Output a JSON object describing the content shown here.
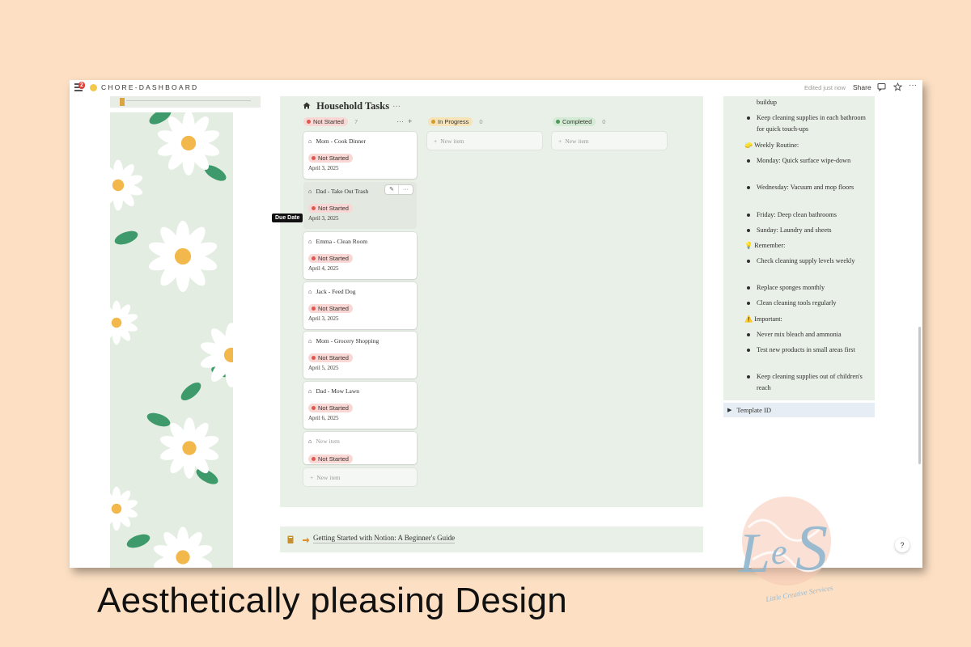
{
  "topbar": {
    "notification_count": "2",
    "page_name": "CHORE-DASHBOARD",
    "edited": "Edited just now",
    "share": "Share"
  },
  "board": {
    "title": "Household Tasks",
    "columns": [
      {
        "status": "Not Started",
        "count": "7",
        "color": "#f8d7d5",
        "dot": "#e0574f"
      },
      {
        "status": "In Progress",
        "count": "0",
        "color": "#f6e3b8",
        "dot": "#d29a2c"
      },
      {
        "status": "Completed",
        "count": "0",
        "color": "#d3ead5",
        "dot": "#4c9a5a"
      }
    ],
    "cards": [
      {
        "title": "Mom - Cook Dinner",
        "status": "Not Started",
        "date": "April 3, 2025"
      },
      {
        "title": "Dad - Take Out Trash",
        "status": "Not Started",
        "date": "April 3, 2025"
      },
      {
        "title": "Emma - Clean Room",
        "status": "Not Started",
        "date": "April 4, 2025"
      },
      {
        "title": "Jack - Feed Dog",
        "status": "Not Started",
        "date": "April 3, 2025"
      },
      {
        "title": "Mom - Grocery Shopping",
        "status": "Not Started",
        "date": "April 5, 2025"
      },
      {
        "title": "Dad - Mow Lawn",
        "status": "Not Started",
        "date": "April 6, 2025"
      },
      {
        "title": "New item",
        "status": "Not Started",
        "date": ""
      }
    ],
    "new_item": "New item",
    "tooltip": "Due Date"
  },
  "callout": {
    "link_text": "Getting Started with Notion: A Beginner's Guide"
  },
  "right_panel": {
    "items": [
      {
        "type": "cont",
        "text": "buildup"
      },
      {
        "type": "bullet",
        "text": "Keep cleaning supplies in each bathroom for quick touch-ups"
      },
      {
        "type": "head",
        "text": "🧽 Weekly Routine:"
      },
      {
        "type": "bullet",
        "text": "Monday: Quick surface wipe-down"
      },
      {
        "type": "bullet",
        "text": "Wednesday: Vacuum and mop floors"
      },
      {
        "type": "bullet",
        "text": "Friday: Deep clean bathrooms"
      },
      {
        "type": "bullet",
        "text": "Sunday: Laundry and sheets"
      },
      {
        "type": "head",
        "text": "💡 Remember:"
      },
      {
        "type": "bullet",
        "text": "Check cleaning supply levels weekly"
      },
      {
        "type": "bullet",
        "text": "Replace sponges monthly"
      },
      {
        "type": "bullet",
        "text": "Clean cleaning tools regularly"
      },
      {
        "type": "head",
        "text": "⚠️ Important:"
      },
      {
        "type": "bullet",
        "text": "Never mix bleach and ammonia"
      },
      {
        "type": "bullet",
        "text": "Test new products in small areas first"
      },
      {
        "type": "bullet",
        "text": "Keep cleaning supplies out of children's reach"
      }
    ],
    "template_toggle": "Template ID"
  },
  "caption": "Aesthetically pleasing Design",
  "logo": {
    "letters": "LeS",
    "tagline": "Little Creative Services"
  },
  "colors": {
    "background": "#fde0c4",
    "panel": "#e9f0e7",
    "petal": "#ffffff",
    "flower_center": "#f2b84b",
    "leaf": "#3f9a6b"
  }
}
